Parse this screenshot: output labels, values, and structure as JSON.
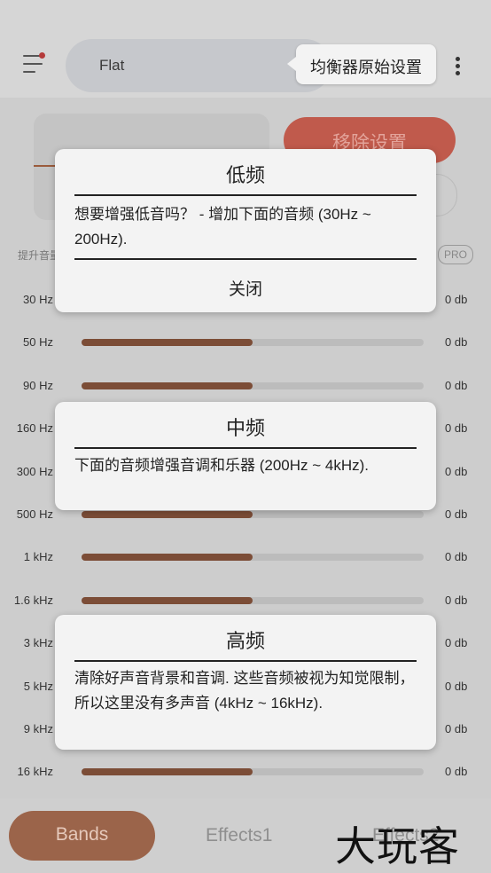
{
  "header": {
    "preset_name": "Flat",
    "tooltip": "均衡器原始设置"
  },
  "panel": {
    "remove_label": "移除设置",
    "section_label": "提升音量",
    "pro_badge": "PRO"
  },
  "bands": [
    {
      "label": "30 Hz",
      "value": "0 db",
      "level": 0.5
    },
    {
      "label": "50 Hz",
      "value": "0 db",
      "level": 0.5
    },
    {
      "label": "90 Hz",
      "value": "0 db",
      "level": 0.5
    },
    {
      "label": "160 Hz",
      "value": "0 db",
      "level": 0.5
    },
    {
      "label": "300 Hz",
      "value": "0 db",
      "level": 0.5
    },
    {
      "label": "500 Hz",
      "value": "0 db",
      "level": 0.5
    },
    {
      "label": "1 kHz",
      "value": "0 db",
      "level": 0.5
    },
    {
      "label": "1.6 kHz",
      "value": "0 db",
      "level": 0.5
    },
    {
      "label": "3 kHz",
      "value": "0 db",
      "level": 0.5
    },
    {
      "label": "5 kHz",
      "value": "0 db",
      "level": 0.5
    },
    {
      "label": "9 kHz",
      "value": "0 db",
      "level": 0.5
    },
    {
      "label": "16 kHz",
      "value": "0 db",
      "level": 0.5
    }
  ],
  "dialogs": {
    "low": {
      "title": "低频",
      "body": "想要增强低音吗？ - 增加下面的音频 (30Hz ~ 200Hz).",
      "close": "关闭"
    },
    "mid": {
      "title": "中频",
      "body": "下面的音频增强音调和乐器 (200Hz ~ 4kHz)."
    },
    "high": {
      "title": "高频",
      "body": "清除好声音背景和音调. 这些音频被视为知觉限制，所以这里没有多声音 (4kHz ~ 16kHz)."
    }
  },
  "nav": {
    "tabs": [
      "Bands",
      "Effects1",
      "Effects2"
    ]
  },
  "watermark": "大玩客",
  "colors": {
    "accent": "#9b644a",
    "fill": "#7c4d37",
    "remove": "#c05a4c"
  }
}
